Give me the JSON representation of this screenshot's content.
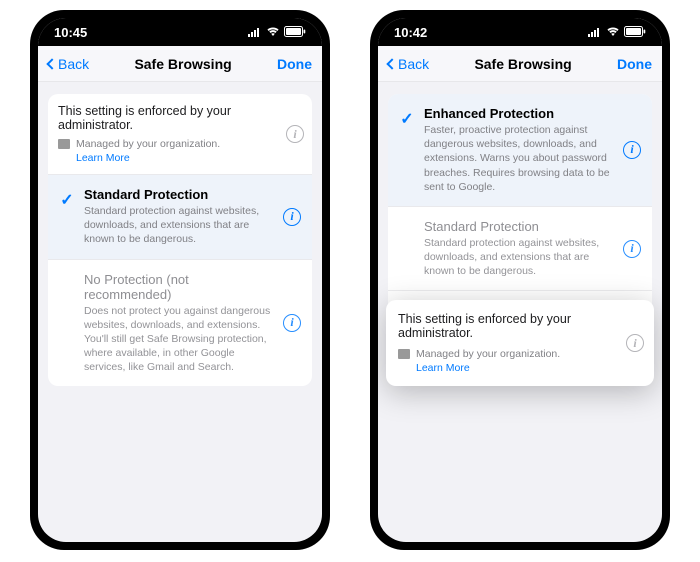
{
  "statusbar": {
    "time_left": "10:45",
    "time_right": "10:42"
  },
  "nav": {
    "back": "Back",
    "title": "Safe Browsing",
    "done": "Done"
  },
  "notice": {
    "title": "This setting is enforced by your administrator.",
    "managed": "Managed by your organization.",
    "learn_more": "Learn More"
  },
  "options": {
    "enhanced": {
      "title": "Enhanced Protection",
      "sub": "Faster, proactive protection against dangerous websites, downloads, and extensions. Warns you about password breaches. Requires browsing data to be sent to Google."
    },
    "standard": {
      "title": "Standard Protection",
      "sub": "Standard protection against websites, downloads, and extensions that are known to be dangerous."
    },
    "none": {
      "title": "No Protection (not recommended)",
      "title_short": "No Protection (not",
      "sub": "Does not protect you against dangerous websites, downloads, and extensions. You'll still get Safe Browsing protection, where available, in other Google services, like Gmail and Search."
    }
  },
  "peek_text": "and Search."
}
